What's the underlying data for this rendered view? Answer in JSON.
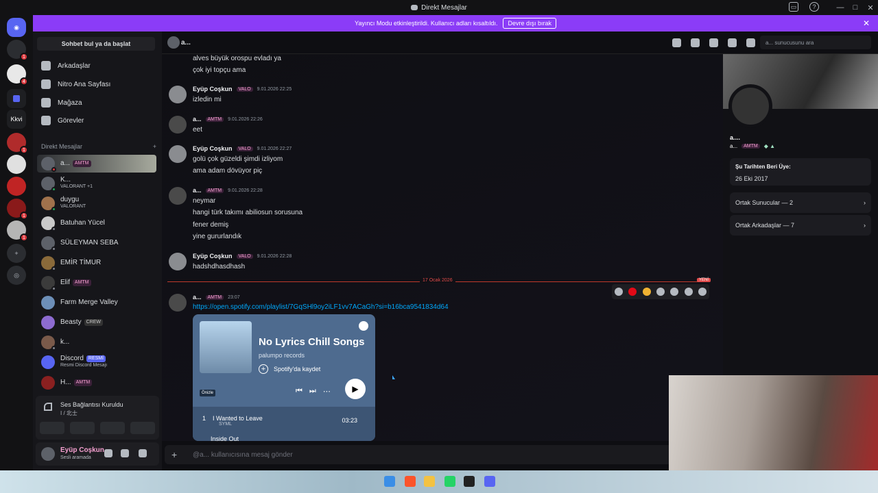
{
  "window": {
    "title": "Direkt Mesajlar"
  },
  "banner": {
    "text": "Yayıncı Modu etkinleştirildi. Kullanıcı adları kısaltıldı.",
    "button": "Devre dışı bırak"
  },
  "guilds": {
    "kkvi_label": "Kkvi",
    "badges": [
      "1",
      "4",
      "1",
      "1",
      "1"
    ]
  },
  "sidebar": {
    "search_label": "Sohbet bul ya da başlat",
    "nav": [
      "Arkadaşlar",
      "Nitro Ana Sayfası",
      "Mağaza",
      "Görevler"
    ],
    "dm_header": "Direkt Mesajlar",
    "dms": [
      {
        "name": "a...",
        "tag": "AMTM",
        "status": ""
      },
      {
        "name": "K...",
        "tag": "",
        "status": "VALORANT +1"
      },
      {
        "name": "duygu",
        "tag": "",
        "status": "VALORANT"
      },
      {
        "name": "Batuhan Yücel",
        "tag": "",
        "status": ""
      },
      {
        "name": "SÜLEYMAN SEBA",
        "tag": "",
        "status": ""
      },
      {
        "name": "EMİR TİMUR",
        "tag": "",
        "status": ""
      },
      {
        "name": "Elif",
        "tag": "AMTM",
        "status": ""
      },
      {
        "name": "Farm Merge Valley",
        "tag": "",
        "status": ""
      },
      {
        "name": "Beasty",
        "tag": "CREW",
        "status": ""
      },
      {
        "name": "k...",
        "tag": "",
        "status": ""
      },
      {
        "name": "Discord",
        "tag": "RESMİ",
        "status": "Resmi Discord Mesajı"
      },
      {
        "name": "H...",
        "tag": "AMTM",
        "status": ""
      }
    ],
    "voice": {
      "title": "Ses Bağlantısı Kuruldu",
      "sub": "I / 北士"
    },
    "user": {
      "name": "Eyüp Coşkun",
      "status": "Sesli aramada"
    }
  },
  "chat": {
    "header_name": "a...",
    "search_placeholder": "a... sunucusunu ara",
    "top_lines": [
      "alves büyük orospu evladı ya",
      "çok iyi topçu ama"
    ],
    "messages": [
      {
        "user": "Eyüp Coşkun",
        "tag": "VALO",
        "time": "9.01.2026 22:25",
        "lines": [
          "izledin mi"
        ]
      },
      {
        "user": "a...",
        "tag": "AMTM",
        "time": "9.01.2026 22:26",
        "lines": [
          "eet"
        ]
      },
      {
        "user": "Eyüp Coşkun",
        "tag": "VALO",
        "time": "9.01.2026 22:27",
        "lines": [
          "golü çok güzeldi şimdi izliyom",
          "ama adam dövüyor piç"
        ]
      },
      {
        "user": "a...",
        "tag": "AMTM",
        "time": "9.01.2026 22:28",
        "lines": [
          "neymar",
          "hangi türk takımı abiliosun sorusuna",
          "fener demiş",
          "yine gururlandık"
        ]
      },
      {
        "user": "Eyüp Coşkun",
        "tag": "VALO",
        "time": "9.01.2026 22:28",
        "lines": [
          "hadshdhasdhash"
        ]
      }
    ],
    "divider": {
      "date": "17 Ocak 2026",
      "new": "YENİ"
    },
    "last": {
      "user": "a...",
      "tag": "AMTM",
      "time": "23:07",
      "link": "https://open.spotify.com/playlist/7GqSHl9oy2iLF1vv7ACaGh?si=b16bca9541834d64"
    },
    "spotify": {
      "title": "No Lyrics Chill Songs",
      "owner": "palumpo records",
      "save": "Spotify'da kaydet",
      "preview": "Önizle",
      "tracks": [
        {
          "num": "1",
          "name": "I Wanted to Leave",
          "artist": "SYML",
          "dur": "03:23"
        },
        {
          "num": "",
          "name": "Inside Out",
          "artist": "",
          "dur": ""
        }
      ]
    },
    "input_placeholder": "@a... kullanıcısına mesaj gönder"
  },
  "profile": {
    "name": "a....",
    "handle": "a...",
    "tag": "AMTM",
    "member_since_label": "Şu Tarihten Beri Üye:",
    "member_since": "26 Eki 2017",
    "mutual_servers": "Ortak Sunucular — 2",
    "mutual_friends": "Ortak Arkadaşlar — 7"
  },
  "colors": {
    "accent": "#8b3cf7",
    "link": "#00a8fc",
    "danger": "#da373c",
    "spotify_card": "#4e6b8f"
  }
}
